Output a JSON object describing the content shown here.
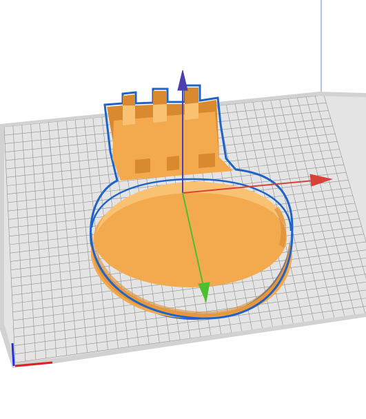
{
  "viewport": {
    "background": "#ffffff",
    "build_plate": {
      "fill": "#e4e4e4",
      "border_fill": "#d2d2d2",
      "grid_color": "#8f8f8f"
    },
    "build_volume_edge_color": "#5a8fd0",
    "model": {
      "shape": "castle-tower-cutter",
      "body_color": "#f3a94e",
      "light_color": "#f9c172",
      "dark_color": "#d98a2f",
      "outline_color": "#1f63c9",
      "selected": true
    },
    "gizmo": {
      "x_axis_color": "#d8403a",
      "y_axis_color": "#4bbf2e",
      "z_axis_color": "#4a3fb0"
    },
    "origin_axes": {
      "x_color": "#e02020",
      "y_color": "#2030e0"
    }
  }
}
